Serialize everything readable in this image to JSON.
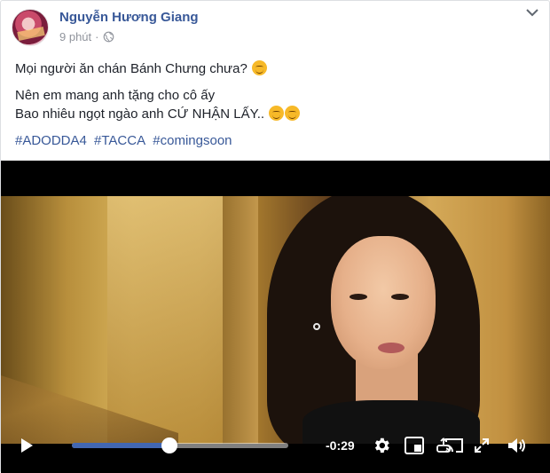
{
  "post": {
    "author": "Nguyễn Hương Giang",
    "time": "9 phút",
    "separator": "·",
    "privacy_icon": "globe-icon",
    "menu_icon": "chevron-down-icon",
    "lines": [
      "Mọi người ăn chán Bánh Chưng chưa?",
      "Nên em mang anh tặng cho cô ấy",
      "Bao nhiêu ngọt ngào anh CỨ NHẬN LẤY.."
    ],
    "emoji": [
      "relieved-face-emoji",
      "smiling-face-emoji"
    ],
    "hashtags": [
      "#ADODDA4",
      "#TACCA",
      "#comingsoon"
    ]
  },
  "video": {
    "time_remaining": "-0:29",
    "progress": 0.45,
    "accent": "#4267b2",
    "controls": [
      "play-icon",
      "gear-icon",
      "picture-in-picture-icon",
      "vr-icon",
      "cast-icon",
      "fullscreen-icon",
      "volume-icon"
    ]
  }
}
